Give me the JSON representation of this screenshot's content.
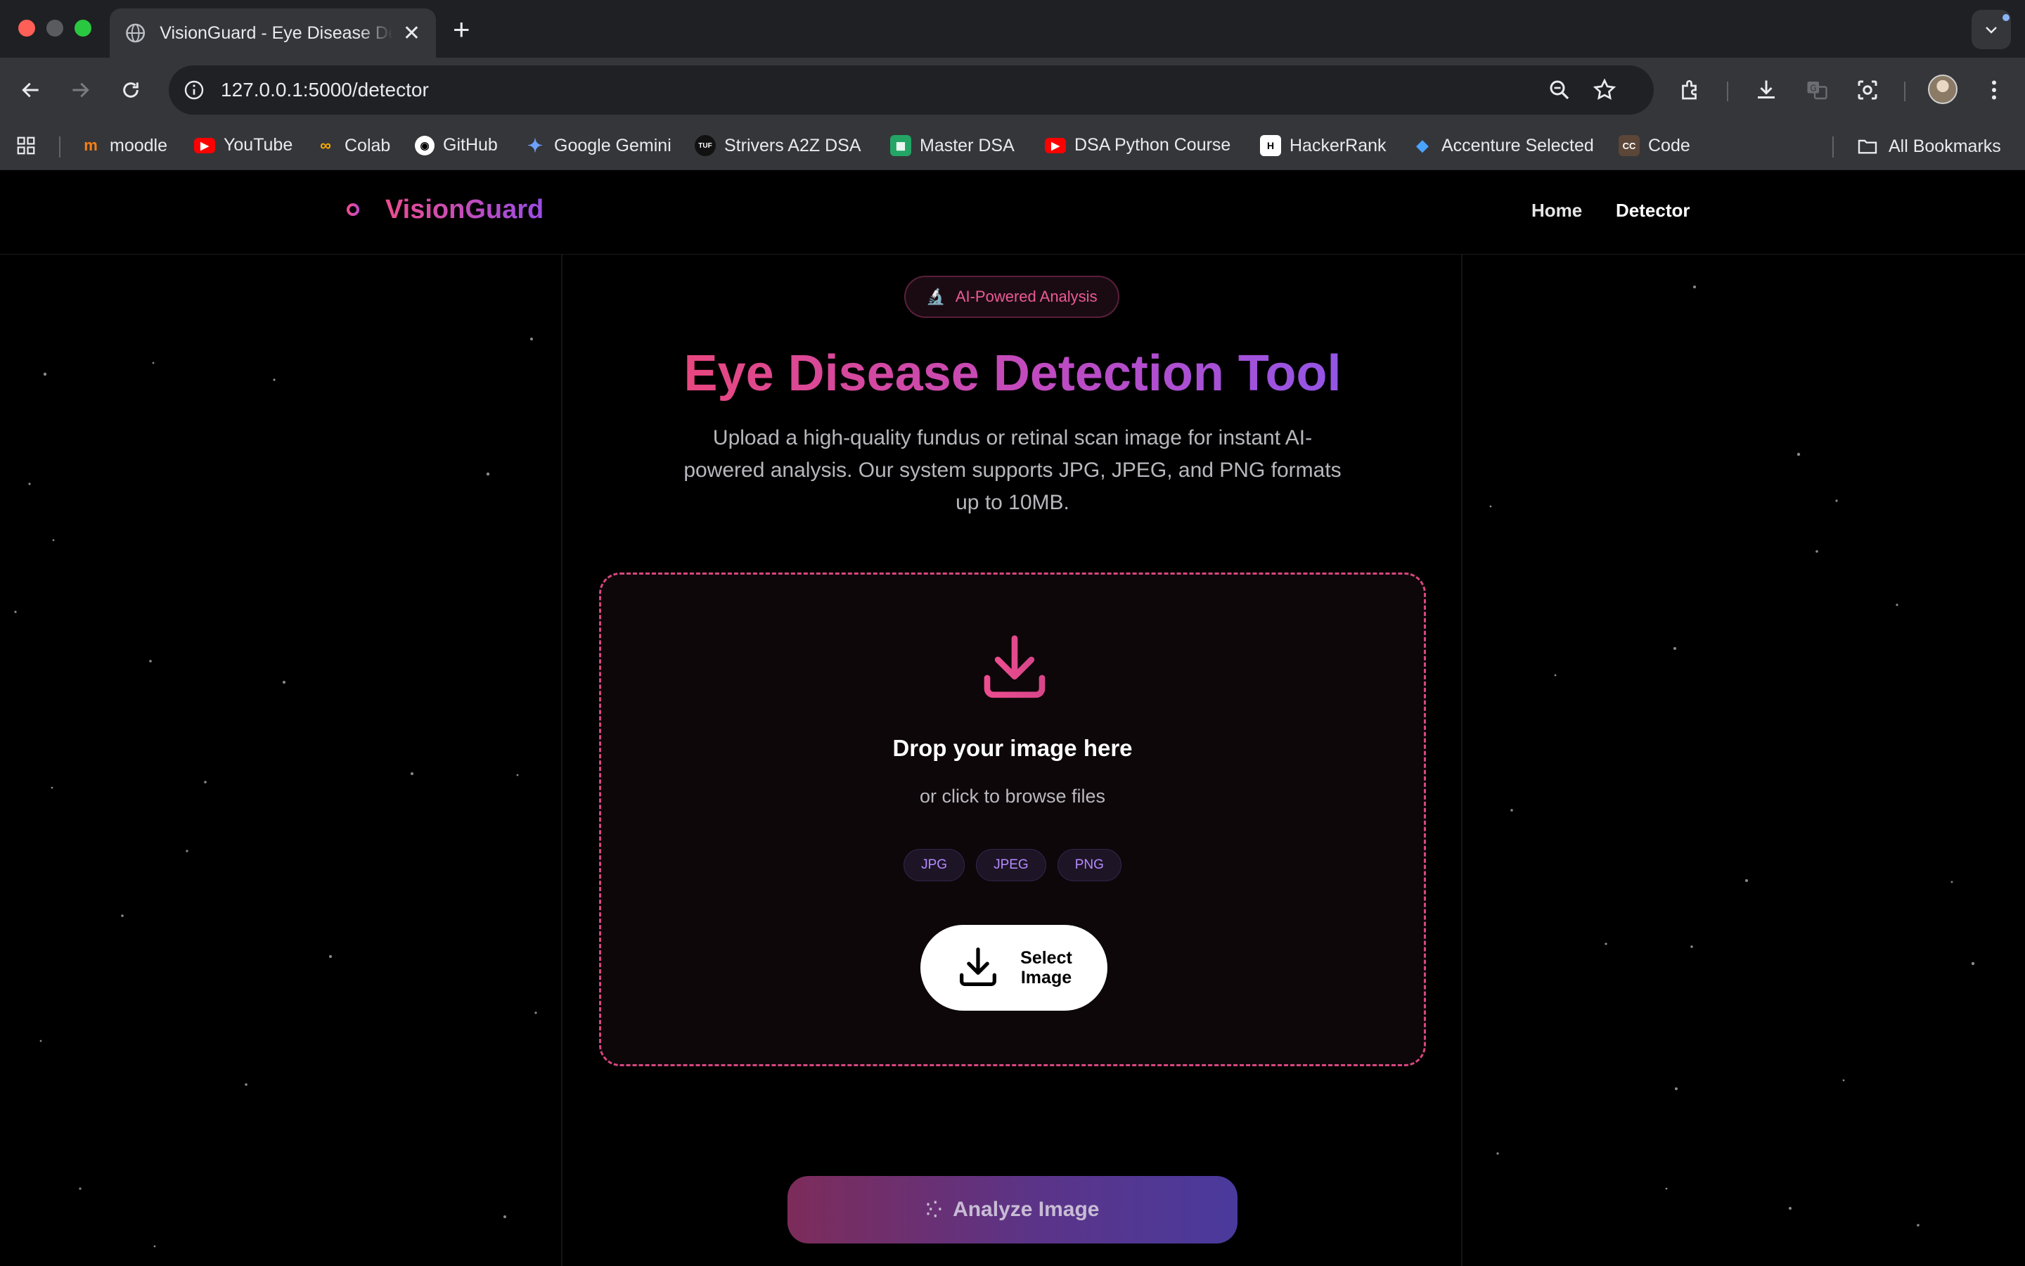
{
  "browser": {
    "tab_title": "VisionGuard - Eye Disease Detector",
    "url": "127.0.0.1:5000/detector",
    "bookmarks": [
      {
        "label": "moodle",
        "icon": "moodle-icon"
      },
      {
        "label": "YouTube",
        "icon": "youtube-icon"
      },
      {
        "label": "Colab",
        "icon": "colab-icon"
      },
      {
        "label": "GitHub",
        "icon": "github-icon"
      },
      {
        "label": "Google Gemini",
        "icon": "gemini-icon"
      },
      {
        "label": "Strivers A2Z DSA",
        "icon": "tuf-icon"
      },
      {
        "label": "Master DSA",
        "icon": "sheets-icon"
      },
      {
        "label": "DSA Python Course",
        "icon": "youtube-icon"
      },
      {
        "label": "HackerRank",
        "icon": "hackerrank-icon"
      },
      {
        "label": "Accenture Selected",
        "icon": "accenture-icon"
      },
      {
        "label": "Code",
        "icon": "codechef-icon"
      }
    ],
    "all_bookmarks": "All Bookmarks"
  },
  "site": {
    "brand": "VisionGuard",
    "nav": {
      "home": "Home",
      "detector": "Detector"
    }
  },
  "hero": {
    "badge": "AI-Powered Analysis",
    "title": "Eye Disease Detection Tool",
    "subtitle": "Upload a high-quality fundus or retinal scan image for instant AI-powered analysis. Our system supports JPG, JPEG, and PNG formats up to 10MB."
  },
  "upload": {
    "title": "Drop your image here",
    "subtitle": "or click to browse files",
    "formats": [
      "JPG",
      "JPEG",
      "PNG"
    ],
    "select_button": "Select Image"
  },
  "analyze_button": "Analyze Image",
  "colors": {
    "accent_pink": "#ec4d8e",
    "accent_purple": "#9a4de6",
    "background": "#000000"
  }
}
